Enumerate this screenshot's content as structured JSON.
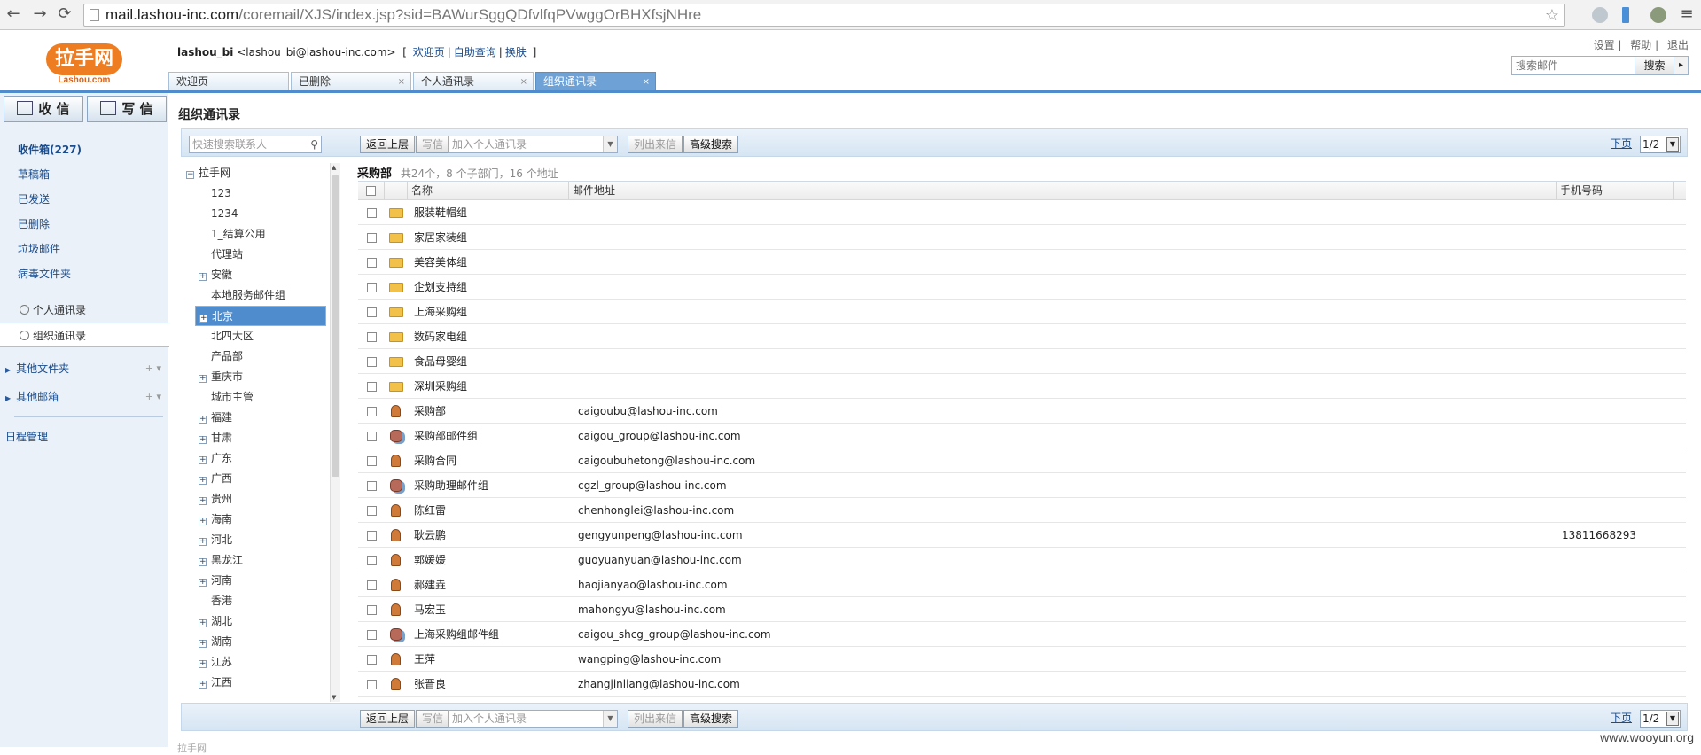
{
  "browser": {
    "url_host": "mail.lashou-inc.com",
    "url_path": "/coremail/XJS/index.jsp?sid=BAWurSggQDfvlfqPVwggOrBHXfsjNHre"
  },
  "header": {
    "logo_text": "拉手网",
    "logo_sub": "Lashou.com",
    "user_name": "lashou_bi",
    "user_email": "<lashou_bi@lashou-inc.com>",
    "links": [
      "欢迎页",
      "自助查询",
      "换肤"
    ],
    "top_links": [
      "设置",
      "帮助",
      "退出"
    ],
    "search_placeholder": "搜索邮件",
    "search_button": "搜索"
  },
  "tabs": [
    {
      "label": "欢迎页"
    },
    {
      "label": "已删除"
    },
    {
      "label": "个人通讯录"
    },
    {
      "label": "组织通讯录"
    }
  ],
  "sidebar": {
    "receive": "收 信",
    "compose": "写 信",
    "folders": [
      "收件箱(227)",
      "草稿箱",
      "已发送",
      "已删除",
      "垃圾邮件",
      "病毒文件夹"
    ],
    "contacts": [
      "个人通讯录",
      "组织通讯录"
    ],
    "other_folders": "其他文件夹",
    "other_mailbox": "其他邮箱",
    "schedule": "日程管理"
  },
  "main": {
    "title": "组织通讯录",
    "toolbar": {
      "quick_search_placeholder": "快速搜索联系人",
      "back": "返回上层",
      "write": "写信",
      "add_personal": "加入个人通讯录",
      "list_mails": "列出来信",
      "advanced": "高级搜索",
      "next_page": "下页",
      "page": "1/2"
    },
    "tree": [
      {
        "label": "拉手网",
        "toggle": "−",
        "indent": 1
      },
      {
        "label": "123",
        "indent": 2
      },
      {
        "label": "1234",
        "indent": 2
      },
      {
        "label": "1_结算公用",
        "indent": 2
      },
      {
        "label": "代理站",
        "indent": 2
      },
      {
        "label": "安徽",
        "toggle": "+",
        "indent": 2
      },
      {
        "label": "本地服务邮件组",
        "indent": 2
      },
      {
        "label": "北京",
        "toggle": "+",
        "indent": 2,
        "selected": true
      },
      {
        "label": "北四大区",
        "indent": 2
      },
      {
        "label": "产品部",
        "indent": 2
      },
      {
        "label": "重庆市",
        "toggle": "+",
        "indent": 2
      },
      {
        "label": "城市主管",
        "indent": 2
      },
      {
        "label": "福建",
        "toggle": "+",
        "indent": 2
      },
      {
        "label": "甘肃",
        "toggle": "+",
        "indent": 2
      },
      {
        "label": "广东",
        "toggle": "+",
        "indent": 2
      },
      {
        "label": "广西",
        "toggle": "+",
        "indent": 2
      },
      {
        "label": "贵州",
        "toggle": "+",
        "indent": 2
      },
      {
        "label": "海南",
        "toggle": "+",
        "indent": 2
      },
      {
        "label": "河北",
        "toggle": "+",
        "indent": 2
      },
      {
        "label": "黑龙江",
        "toggle": "+",
        "indent": 2
      },
      {
        "label": "河南",
        "toggle": "+",
        "indent": 2
      },
      {
        "label": "香港",
        "indent": 2
      },
      {
        "label": "湖北",
        "toggle": "+",
        "indent": 2
      },
      {
        "label": "湖南",
        "toggle": "+",
        "indent": 2
      },
      {
        "label": "江苏",
        "toggle": "+",
        "indent": 2
      },
      {
        "label": "江西",
        "toggle": "+",
        "indent": 2
      }
    ],
    "dept_name": "采购部",
    "dept_info": "共24个，8 个子部门，16 个地址",
    "columns": {
      "name": "名称",
      "mail": "邮件地址",
      "phone": "手机号码"
    },
    "rows": [
      {
        "type": "folder",
        "name": "服装鞋帽组",
        "mail": "",
        "phone": ""
      },
      {
        "type": "folder",
        "name": "家居家装组",
        "mail": "",
        "phone": ""
      },
      {
        "type": "folder",
        "name": "美容美体组",
        "mail": "",
        "phone": ""
      },
      {
        "type": "folder",
        "name": "企划支持组",
        "mail": "",
        "phone": ""
      },
      {
        "type": "folder",
        "name": "上海采购组",
        "mail": "",
        "phone": ""
      },
      {
        "type": "folder",
        "name": "数码家电组",
        "mail": "",
        "phone": ""
      },
      {
        "type": "folder",
        "name": "食品母婴组",
        "mail": "",
        "phone": ""
      },
      {
        "type": "folder",
        "name": "深圳采购组",
        "mail": "",
        "phone": ""
      },
      {
        "type": "person",
        "name": "采购部",
        "mail": "caigoubu@lashou-inc.com",
        "phone": ""
      },
      {
        "type": "group",
        "name": "采购部邮件组",
        "mail": "caigou_group@lashou-inc.com",
        "phone": ""
      },
      {
        "type": "person",
        "name": "采购合同",
        "mail": "caigoubuhetong@lashou-inc.com",
        "phone": ""
      },
      {
        "type": "group",
        "name": "采购助理邮件组",
        "mail": "cgzl_group@lashou-inc.com",
        "phone": ""
      },
      {
        "type": "person",
        "name": "陈红雷",
        "mail": "chenhonglei@lashou-inc.com",
        "phone": ""
      },
      {
        "type": "person",
        "name": "耿云鹏",
        "mail": "gengyunpeng@lashou-inc.com",
        "phone": "13811668293"
      },
      {
        "type": "person",
        "name": "郭媛媛",
        "mail": "guoyuanyuan@lashou-inc.com",
        "phone": ""
      },
      {
        "type": "person",
        "name": "郝建垚",
        "mail": "haojianyao@lashou-inc.com",
        "phone": ""
      },
      {
        "type": "person",
        "name": "马宏玉",
        "mail": "mahongyu@lashou-inc.com",
        "phone": ""
      },
      {
        "type": "group",
        "name": "上海采购组邮件组",
        "mail": "caigou_shcg_group@lashou-inc.com",
        "phone": ""
      },
      {
        "type": "person",
        "name": "王萍",
        "mail": "wangping@lashou-inc.com",
        "phone": ""
      },
      {
        "type": "person",
        "name": "张晋良",
        "mail": "zhangjinliang@lashou-inc.com",
        "phone": ""
      }
    ]
  },
  "footer": "拉手网",
  "watermark": "www.wooyun.org",
  "colors": {
    "accent": "#4f8ccd",
    "link": "#1a4d8f",
    "brand": "#ee7d21"
  }
}
